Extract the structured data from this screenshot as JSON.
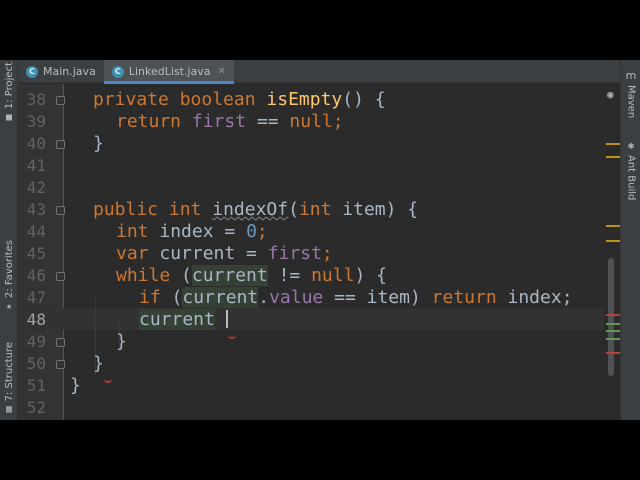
{
  "tabs": [
    {
      "label": "Main.java",
      "icon": "class-icon",
      "active": false
    },
    {
      "label": "LinkedList.java",
      "icon": "class-icon",
      "active": true
    }
  ],
  "left_tools": {
    "project": "1: Project",
    "favorites": "2: Favorites",
    "structure": "7: Structure"
  },
  "right_tools": {
    "maven": "Maven",
    "ant": "Ant Build"
  },
  "editor": {
    "current_line": "48",
    "line_numbers": [
      "38",
      "39",
      "40",
      "41",
      "42",
      "43",
      "44",
      "45",
      "46",
      "47",
      "48",
      "49",
      "50",
      "51",
      "52"
    ]
  },
  "code": {
    "l38": {
      "kw1": "private",
      "kw2": "boolean",
      "fn": "isEmpty",
      "rest": "() {"
    },
    "l39": {
      "kw": "return",
      "field": "first",
      "rest1": " == ",
      "kw2": "null",
      "rest2": ";"
    },
    "l40": {
      "text": "}"
    },
    "l43": {
      "kw1": "public",
      "kw2": "int",
      "fn": "indexOf",
      "p1": "(",
      "kw3": "int",
      "rest": " item) {"
    },
    "l44": {
      "kw": "int",
      "rest": " index = ",
      "num": "0",
      "end": ";"
    },
    "l45": {
      "kw": "var",
      "rest": " current = ",
      "field": "first",
      "end": ";"
    },
    "l46": {
      "kw": "while",
      "p1": " (",
      "hl": "current",
      "rest": " != ",
      "kw2": "null",
      "end": ") {"
    },
    "l47": {
      "kw": "if",
      "p1": " (",
      "hl": "current",
      "dot": ".",
      "field": "value",
      "rest": " == item) ",
      "kw2": "return",
      "end": " index;"
    },
    "l48": {
      "hl": "current",
      "rest": " "
    },
    "l49": {
      "text": "}"
    },
    "l50": {
      "text": "}"
    },
    "l51": {
      "text": "}"
    }
  },
  "colors": {
    "background": "#2b2b2b",
    "keyword": "#cc7832",
    "function": "#ffc66d",
    "field": "#9876aa",
    "number": "#6897bb",
    "text": "#a9b7c6",
    "error": "#bc3f3c",
    "warning_marker": "#be9117",
    "change_marker": "#629755"
  }
}
